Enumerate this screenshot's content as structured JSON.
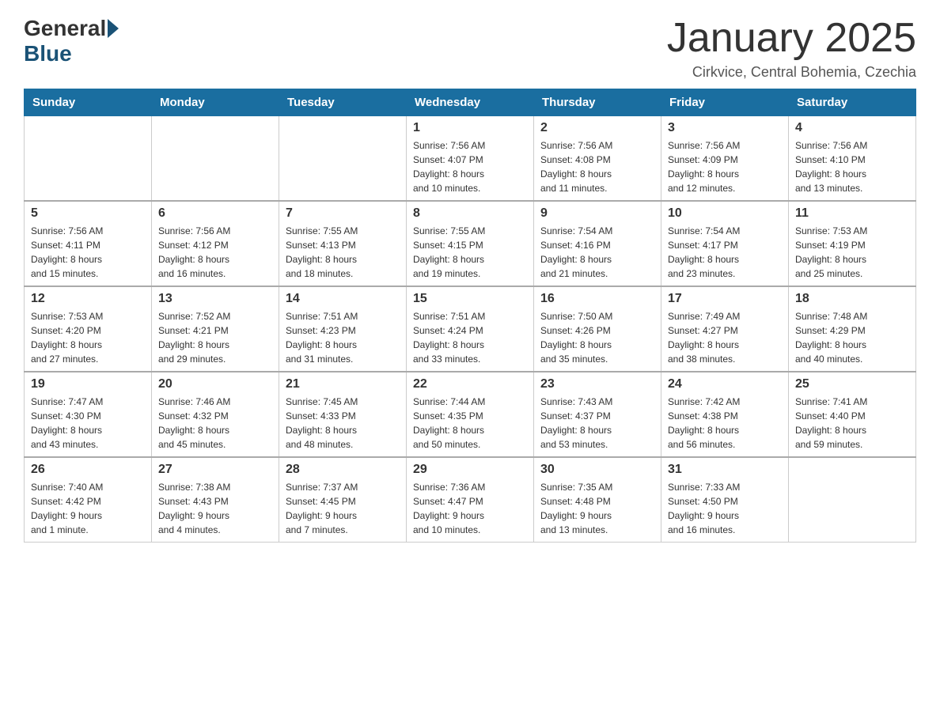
{
  "header": {
    "logo_general": "General",
    "logo_blue": "Blue",
    "title": "January 2025",
    "location": "Cirkvice, Central Bohemia, Czechia"
  },
  "calendar": {
    "days_of_week": [
      "Sunday",
      "Monday",
      "Tuesday",
      "Wednesday",
      "Thursday",
      "Friday",
      "Saturday"
    ],
    "weeks": [
      [
        {
          "day": "",
          "info": ""
        },
        {
          "day": "",
          "info": ""
        },
        {
          "day": "",
          "info": ""
        },
        {
          "day": "1",
          "info": "Sunrise: 7:56 AM\nSunset: 4:07 PM\nDaylight: 8 hours\nand 10 minutes."
        },
        {
          "day": "2",
          "info": "Sunrise: 7:56 AM\nSunset: 4:08 PM\nDaylight: 8 hours\nand 11 minutes."
        },
        {
          "day": "3",
          "info": "Sunrise: 7:56 AM\nSunset: 4:09 PM\nDaylight: 8 hours\nand 12 minutes."
        },
        {
          "day": "4",
          "info": "Sunrise: 7:56 AM\nSunset: 4:10 PM\nDaylight: 8 hours\nand 13 minutes."
        }
      ],
      [
        {
          "day": "5",
          "info": "Sunrise: 7:56 AM\nSunset: 4:11 PM\nDaylight: 8 hours\nand 15 minutes."
        },
        {
          "day": "6",
          "info": "Sunrise: 7:56 AM\nSunset: 4:12 PM\nDaylight: 8 hours\nand 16 minutes."
        },
        {
          "day": "7",
          "info": "Sunrise: 7:55 AM\nSunset: 4:13 PM\nDaylight: 8 hours\nand 18 minutes."
        },
        {
          "day": "8",
          "info": "Sunrise: 7:55 AM\nSunset: 4:15 PM\nDaylight: 8 hours\nand 19 minutes."
        },
        {
          "day": "9",
          "info": "Sunrise: 7:54 AM\nSunset: 4:16 PM\nDaylight: 8 hours\nand 21 minutes."
        },
        {
          "day": "10",
          "info": "Sunrise: 7:54 AM\nSunset: 4:17 PM\nDaylight: 8 hours\nand 23 minutes."
        },
        {
          "day": "11",
          "info": "Sunrise: 7:53 AM\nSunset: 4:19 PM\nDaylight: 8 hours\nand 25 minutes."
        }
      ],
      [
        {
          "day": "12",
          "info": "Sunrise: 7:53 AM\nSunset: 4:20 PM\nDaylight: 8 hours\nand 27 minutes."
        },
        {
          "day": "13",
          "info": "Sunrise: 7:52 AM\nSunset: 4:21 PM\nDaylight: 8 hours\nand 29 minutes."
        },
        {
          "day": "14",
          "info": "Sunrise: 7:51 AM\nSunset: 4:23 PM\nDaylight: 8 hours\nand 31 minutes."
        },
        {
          "day": "15",
          "info": "Sunrise: 7:51 AM\nSunset: 4:24 PM\nDaylight: 8 hours\nand 33 minutes."
        },
        {
          "day": "16",
          "info": "Sunrise: 7:50 AM\nSunset: 4:26 PM\nDaylight: 8 hours\nand 35 minutes."
        },
        {
          "day": "17",
          "info": "Sunrise: 7:49 AM\nSunset: 4:27 PM\nDaylight: 8 hours\nand 38 minutes."
        },
        {
          "day": "18",
          "info": "Sunrise: 7:48 AM\nSunset: 4:29 PM\nDaylight: 8 hours\nand 40 minutes."
        }
      ],
      [
        {
          "day": "19",
          "info": "Sunrise: 7:47 AM\nSunset: 4:30 PM\nDaylight: 8 hours\nand 43 minutes."
        },
        {
          "day": "20",
          "info": "Sunrise: 7:46 AM\nSunset: 4:32 PM\nDaylight: 8 hours\nand 45 minutes."
        },
        {
          "day": "21",
          "info": "Sunrise: 7:45 AM\nSunset: 4:33 PM\nDaylight: 8 hours\nand 48 minutes."
        },
        {
          "day": "22",
          "info": "Sunrise: 7:44 AM\nSunset: 4:35 PM\nDaylight: 8 hours\nand 50 minutes."
        },
        {
          "day": "23",
          "info": "Sunrise: 7:43 AM\nSunset: 4:37 PM\nDaylight: 8 hours\nand 53 minutes."
        },
        {
          "day": "24",
          "info": "Sunrise: 7:42 AM\nSunset: 4:38 PM\nDaylight: 8 hours\nand 56 minutes."
        },
        {
          "day": "25",
          "info": "Sunrise: 7:41 AM\nSunset: 4:40 PM\nDaylight: 8 hours\nand 59 minutes."
        }
      ],
      [
        {
          "day": "26",
          "info": "Sunrise: 7:40 AM\nSunset: 4:42 PM\nDaylight: 9 hours\nand 1 minute."
        },
        {
          "day": "27",
          "info": "Sunrise: 7:38 AM\nSunset: 4:43 PM\nDaylight: 9 hours\nand 4 minutes."
        },
        {
          "day": "28",
          "info": "Sunrise: 7:37 AM\nSunset: 4:45 PM\nDaylight: 9 hours\nand 7 minutes."
        },
        {
          "day": "29",
          "info": "Sunrise: 7:36 AM\nSunset: 4:47 PM\nDaylight: 9 hours\nand 10 minutes."
        },
        {
          "day": "30",
          "info": "Sunrise: 7:35 AM\nSunset: 4:48 PM\nDaylight: 9 hours\nand 13 minutes."
        },
        {
          "day": "31",
          "info": "Sunrise: 7:33 AM\nSunset: 4:50 PM\nDaylight: 9 hours\nand 16 minutes."
        },
        {
          "day": "",
          "info": ""
        }
      ]
    ]
  }
}
